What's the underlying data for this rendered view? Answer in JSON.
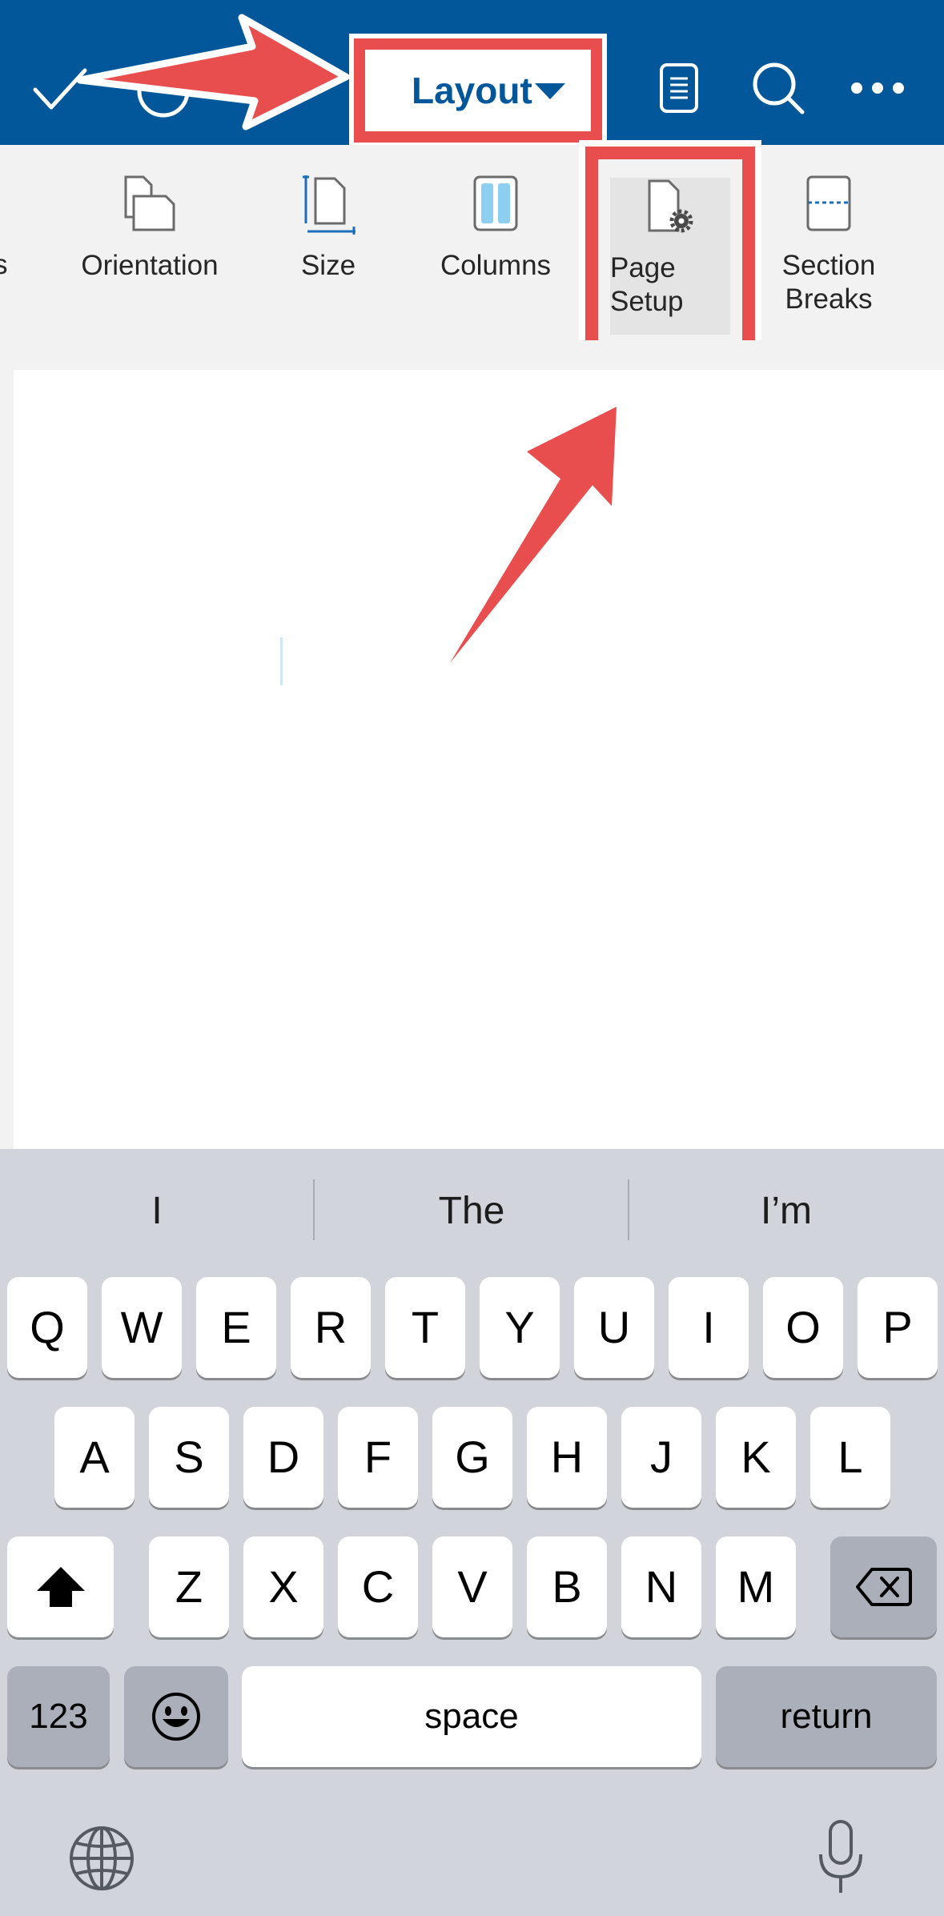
{
  "toolbar": {
    "tab_label": "Layout",
    "icons": [
      "check-icon",
      "undo-icon",
      "view-icon",
      "search-icon",
      "more-icon"
    ]
  },
  "ribbon": {
    "partial_label": "s",
    "items": [
      {
        "label": "Orientation",
        "icon": "orientation-icon"
      },
      {
        "label": "Size",
        "icon": "size-icon"
      },
      {
        "label": "Columns",
        "icon": "columns-icon"
      },
      {
        "label": "Page\nSetup",
        "icon": "page-setup-icon"
      },
      {
        "label": "Section\nBreaks",
        "icon": "section-breaks-icon"
      }
    ]
  },
  "annotation_color": "#e94e4e",
  "brand_color": "#015799",
  "keyboard": {
    "suggestions": [
      "I",
      "The",
      "I’m"
    ],
    "row1": [
      "Q",
      "W",
      "E",
      "R",
      "T",
      "Y",
      "U",
      "I",
      "O",
      "P"
    ],
    "row2": [
      "A",
      "S",
      "D",
      "F",
      "G",
      "H",
      "J",
      "K",
      "L"
    ],
    "row3": [
      "Z",
      "X",
      "C",
      "V",
      "B",
      "N",
      "M"
    ],
    "numbers_key": "123",
    "space_key": "space",
    "return_key": "return",
    "icons": [
      "shift-icon",
      "backspace-icon",
      "emoji-icon",
      "globe-icon",
      "microphone-icon"
    ]
  }
}
